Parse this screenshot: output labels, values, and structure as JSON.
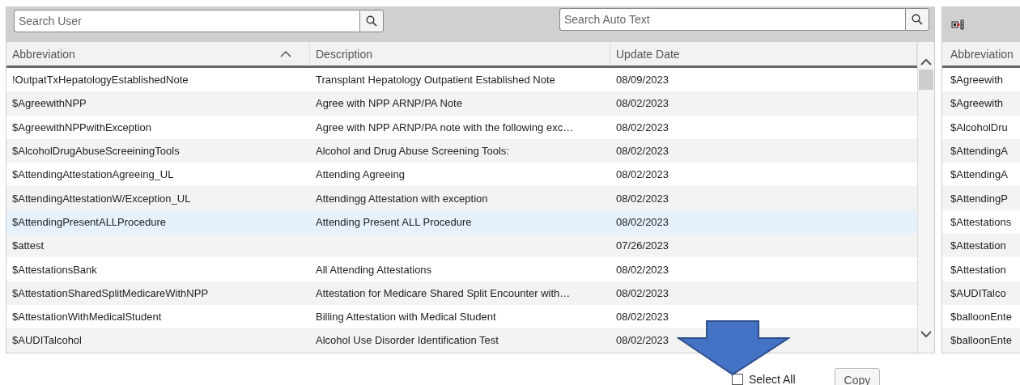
{
  "user_search": {
    "placeholder": "Search User"
  },
  "auto_text_search": {
    "placeholder": "Search Auto Text"
  },
  "table": {
    "columns": [
      {
        "label": "Abbreviation",
        "sorted": true
      },
      {
        "label": "Description",
        "sorted": false
      },
      {
        "label": "Update Date",
        "sorted": false
      }
    ],
    "rows": [
      {
        "abbreviation": "!OutpatTxHepatologyEstablishedNote",
        "description": "Transplant Hepatology Outpatient Established Note",
        "update_date": "08/09/2023",
        "hovered": false
      },
      {
        "abbreviation": "$AgreewithNPP",
        "description": "Agree with NPP ARNP/PA Note",
        "update_date": "08/02/2023",
        "hovered": false
      },
      {
        "abbreviation": "$AgreewithNPPwithException",
        "description": "Agree with NPP ARNP/PA note with the following exc…",
        "update_date": "08/02/2023",
        "hovered": false
      },
      {
        "abbreviation": "$AlcoholDrugAbuseScreeiningTools",
        "description": "Alcohol and Drug Abuse Screening Tools:",
        "update_date": "08/02/2023",
        "hovered": false
      },
      {
        "abbreviation": "$AttendingAttestationAgreeing_UL",
        "description": "Attending Agreeing",
        "update_date": "08/02/2023",
        "hovered": false
      },
      {
        "abbreviation": "$AttendingAttestationW/Exception_UL",
        "description": "Attendingg Attestation with exception",
        "update_date": "08/02/2023",
        "hovered": false
      },
      {
        "abbreviation": "$AttendingPresentALLProcedure",
        "description": "Attending Present ALL Procedure",
        "update_date": "08/02/2023",
        "hovered": true
      },
      {
        "abbreviation": "$attest",
        "description": "",
        "update_date": "07/26/2023",
        "hovered": false
      },
      {
        "abbreviation": "$AttestationsBank",
        "description": "All Attending Attestations",
        "update_date": "08/02/2023",
        "hovered": false
      },
      {
        "abbreviation": "$AttestationSharedSplitMedicareWithNPP",
        "description": "Attestation for Medicare Shared Split Encounter with…",
        "update_date": "08/02/2023",
        "hovered": false
      },
      {
        "abbreviation": "$AttestationWithMedicalStudent",
        "description": "Billing Attestation with Medical Student",
        "update_date": "08/02/2023",
        "hovered": false
      },
      {
        "abbreviation": "$AUDITalcohol",
        "description": "Alcohol Use Disorder Identification Test",
        "update_date": "08/02/2023",
        "hovered": false
      }
    ]
  },
  "side_panel": {
    "column": "Abbreviation",
    "rows": [
      "$Agreewith",
      "$Agreewith",
      "$AlcoholDru",
      "$AttendingA",
      "$AttendingA",
      "$AttendingP",
      "$Attestations",
      "$Attestation",
      "$Attestation",
      "$AUDITalco",
      "$balloonEnte",
      "$balloonEnte"
    ]
  },
  "footer": {
    "select_all": {
      "label": "Select All",
      "checked": false
    },
    "copy_button": "Copy"
  }
}
